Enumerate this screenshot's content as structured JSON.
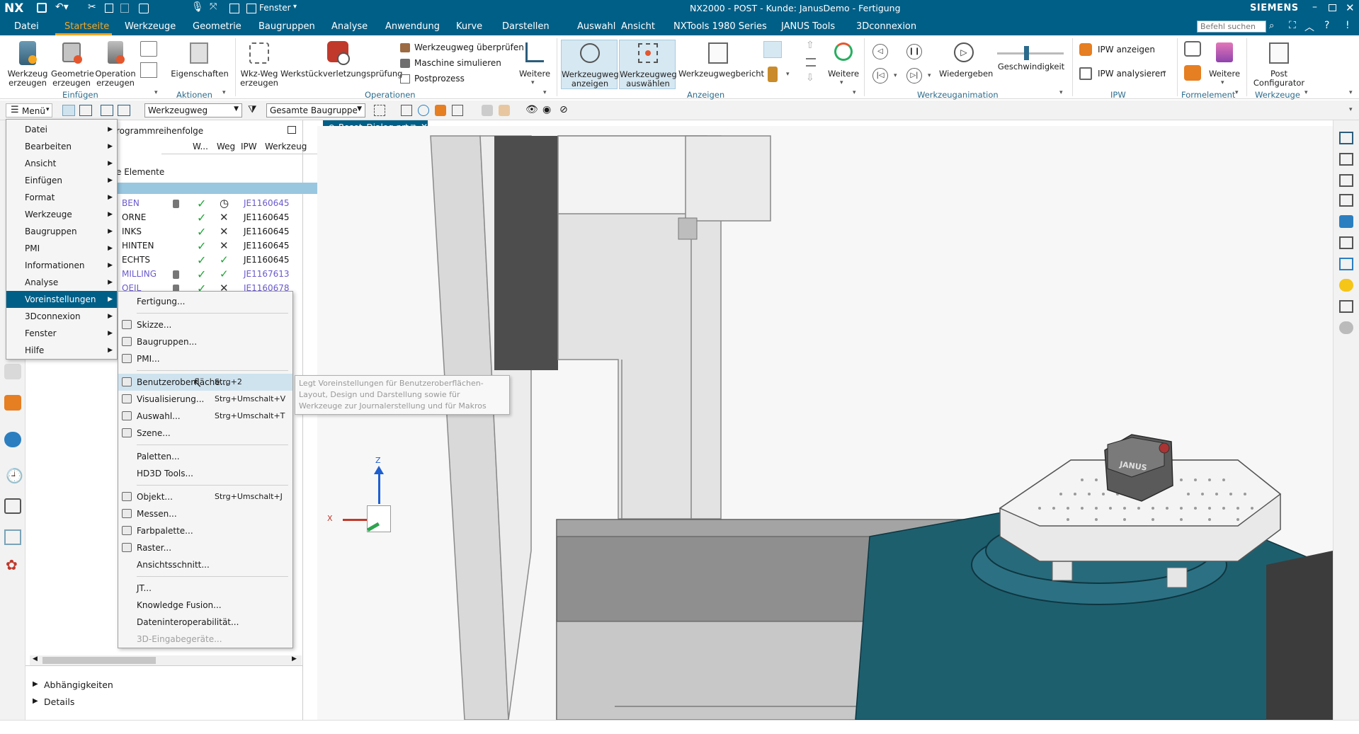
{
  "titlebar": {
    "app_logo": "NX",
    "window_menu": "Fenster",
    "title": "NX2000 - POST - Kunde: JanusDemo - Fertigung",
    "brand": "SIEMENS",
    "search_placeholder": "Befehl suchen"
  },
  "menubar": {
    "items": [
      "Datei",
      "Startseite",
      "Werkzeuge",
      "Geometrie",
      "Baugruppen",
      "Analyse",
      "Anwendung",
      "Kurve",
      "Darstellen",
      "Auswahl",
      "Ansicht",
      "NXTools 1980 Series",
      "JANUS Tools",
      "3Dconnexion"
    ],
    "active": "Startseite"
  },
  "ribbon": {
    "buttons": {
      "werkzeug": "Werkzeug\nerzeugen",
      "geometrie": "Geometrie\nerzeugen",
      "operation": "Operation\nerzeugen",
      "eigenschaften": "Eigenschaften",
      "wkzweg": "Wkz-Weg\nerzeugen",
      "werkstueck": "Werkstückverletzungsprüfung",
      "weg_pruefen": "Werkzeugweg überprüfen",
      "maschine": "Maschine simulieren",
      "postprozess": "Postprozess",
      "weitere1": "Weitere",
      "weg_anzeigen": "Werkzeugweg\nanzeigen",
      "weg_auswaehlen": "Werkzeugweg\nauswählen",
      "weg_bericht": "Werkzeugwegbericht",
      "weitere2": "Weitere",
      "wiedergeben": "Wiedergeben",
      "geschwindigkeit": "Geschwindigkeit",
      "ipw_anzeigen": "IPW anzeigen",
      "ipw_analysieren": "IPW analysieren",
      "weitere3": "Weitere",
      "post_configurator": "Post\nConfigurator"
    },
    "groups": {
      "einfuegen": "Einfügen",
      "aktionen": "Aktionen",
      "operationen": "Operationen",
      "anzeigen": "Anzeigen",
      "animation": "Werkzeuganimation",
      "ipw": "IPW",
      "formelement": "Formelement",
      "werkzeuge": "Werkzeuge"
    }
  },
  "toolbar2": {
    "menu_label": "Menü",
    "filter_select": "Werkzeugweg",
    "scope_select": "Gesamte Baugruppe"
  },
  "tab": {
    "label": "Reset_Dialog.prt"
  },
  "navigator": {
    "title": "rogrammreihenfolge",
    "columns": [
      "W...",
      "Weg",
      "IPW",
      "Werkzeug"
    ],
    "group_row": "e Elemente",
    "rows": [
      {
        "name": "BEN",
        "tool": "JE1160645",
        "link": true,
        "ipw": "clock"
      },
      {
        "name": "ORNE",
        "tool": "JE1160645",
        "link": false,
        "ipw": "x"
      },
      {
        "name": "INKS",
        "tool": "JE1160645",
        "link": false,
        "ipw": "x"
      },
      {
        "name": "HINTEN",
        "tool": "JE1160645",
        "link": false,
        "ipw": "x"
      },
      {
        "name": "ECHTS",
        "tool": "JE1160645",
        "link": false,
        "ipw": "check"
      },
      {
        "name": "MILLING",
        "tool": "JE1167613",
        "link": true,
        "ipw": "check"
      },
      {
        "name": "OEIL",
        "tool": "JE1160678",
        "link": true,
        "ipw": "x"
      }
    ],
    "abhaengigkeiten": "Abhängigkeiten",
    "details": "Details"
  },
  "main_menu": {
    "items": [
      "Datei",
      "Bearbeiten",
      "Ansicht",
      "Einfügen",
      "Format",
      "Werkzeuge",
      "Baugruppen",
      "PMI",
      "Informationen",
      "Analyse",
      "Voreinstellungen",
      "3Dconnexion",
      "Fenster",
      "Hilfe"
    ],
    "active": "Voreinstellungen"
  },
  "submenu": {
    "items": [
      {
        "label": "Fertigung...",
        "shortcut": "",
        "icon": false,
        "sep_after": true
      },
      {
        "label": "Skizze...",
        "shortcut": "",
        "icon": true
      },
      {
        "label": "Baugruppen...",
        "shortcut": "",
        "icon": true
      },
      {
        "label": "PMI...",
        "shortcut": "",
        "icon": true,
        "sep_after": true
      },
      {
        "label": "Benutzeroberfläche...",
        "shortcut": "Strg+2",
        "icon": true,
        "hover": true
      },
      {
        "label": "Visualisierung...",
        "shortcut": "Strg+Umschalt+V",
        "icon": true
      },
      {
        "label": "Auswahl...",
        "shortcut": "Strg+Umschalt+T",
        "icon": true
      },
      {
        "label": "Szene...",
        "shortcut": "",
        "icon": true,
        "sep_after": true
      },
      {
        "label": "Paletten...",
        "shortcut": "",
        "icon": false
      },
      {
        "label": "HD3D Tools...",
        "shortcut": "",
        "icon": false,
        "sep_after": true
      },
      {
        "label": "Objekt...",
        "shortcut": "Strg+Umschalt+J",
        "icon": true
      },
      {
        "label": "Messen...",
        "shortcut": "",
        "icon": true
      },
      {
        "label": "Farbpalette...",
        "shortcut": "",
        "icon": true
      },
      {
        "label": "Raster...",
        "shortcut": "",
        "icon": true
      },
      {
        "label": "Ansichtsschnitt...",
        "shortcut": "",
        "icon": false,
        "sep_after": true
      },
      {
        "label": "JT...",
        "shortcut": "",
        "icon": false
      },
      {
        "label": "Knowledge Fusion...",
        "shortcut": "",
        "icon": false
      },
      {
        "label": "Dateninteroperabilität...",
        "shortcut": "",
        "icon": false
      },
      {
        "label": "3D-Eingabegeräte...",
        "shortcut": "",
        "icon": false,
        "disabled": true
      }
    ]
  },
  "tooltip": {
    "text": "Legt Voreinstellungen für Benutzeroberflächen-Layout, Design und Darstellung sowie für Werkzeuge zur Journalerstellung und für Makros fest."
  },
  "viewport": {
    "fixture_label": "JANUS",
    "axis_z": "Z",
    "axis_x": "X"
  },
  "colors": {
    "header": "#005f87",
    "accent": "#f5a623",
    "machine_teal": "#1e5f6e",
    "selection": "#99c7e0"
  }
}
